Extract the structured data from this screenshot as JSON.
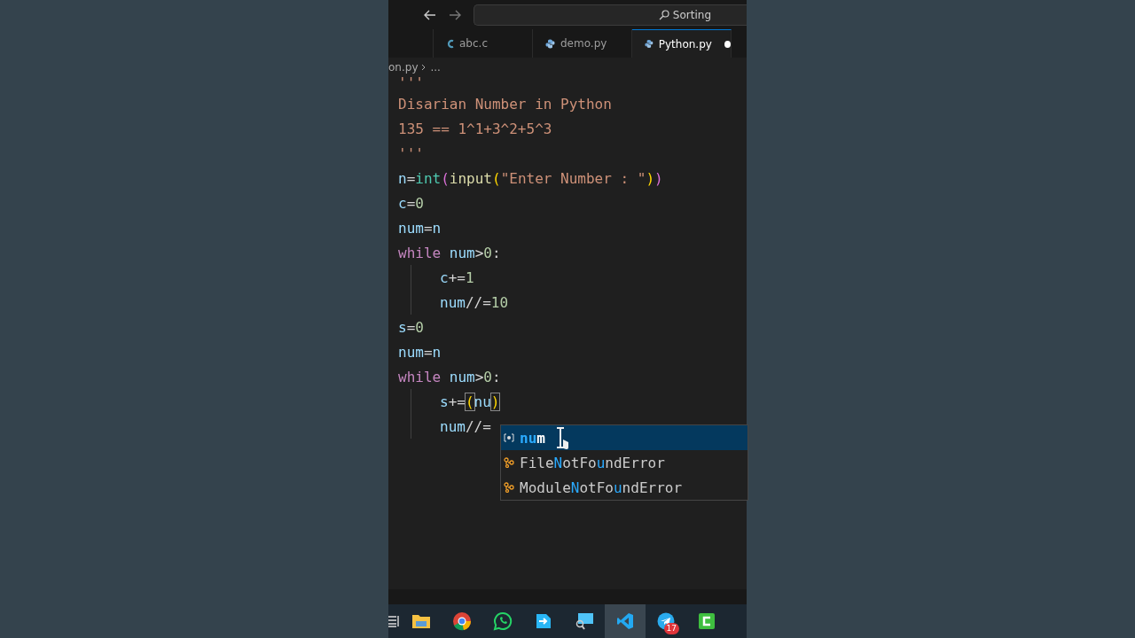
{
  "title_bar": {
    "search": "Sorting"
  },
  "tabs": [
    {
      "label": "abc.c",
      "kind": "c",
      "selected": false,
      "modified": false
    },
    {
      "label": "demo.py",
      "kind": "python",
      "selected": false,
      "modified": false
    },
    {
      "label": "Python.py",
      "kind": "python",
      "selected": true,
      "modified": true
    }
  ],
  "breadcrumb": [
    "on.py",
    "..."
  ],
  "code_lines": [
    {
      "tokens": [
        {
          "text": "'''",
          "kind": "string"
        }
      ]
    },
    {
      "tokens": [
        {
          "text": "Disarian Number in Python",
          "kind": "string"
        }
      ]
    },
    {
      "tokens": [
        {
          "text": "135 == 1^1+3^2+5^3",
          "kind": "string"
        }
      ]
    },
    {
      "tokens": [
        {
          "text": "'''",
          "kind": "string"
        }
      ]
    },
    {
      "tokens": [
        {
          "text": "n",
          "kind": "var"
        },
        {
          "text": "=",
          "kind": "op"
        },
        {
          "text": "int",
          "kind": "builtin"
        },
        {
          "text": "(",
          "kind": "paren"
        },
        {
          "text": "input",
          "kind": "func"
        },
        {
          "text": "(",
          "kind": "paren2"
        },
        {
          "text": "\"Enter Number : \"",
          "kind": "string"
        },
        {
          "text": ")",
          "kind": "paren2"
        },
        {
          "text": ")",
          "kind": "paren"
        }
      ]
    },
    {
      "tokens": [
        {
          "text": "c",
          "kind": "var"
        },
        {
          "text": "=",
          "kind": "op"
        },
        {
          "text": "0",
          "kind": "number"
        }
      ]
    },
    {
      "tokens": [
        {
          "text": "num",
          "kind": "var"
        },
        {
          "text": "=",
          "kind": "op"
        },
        {
          "text": "n",
          "kind": "var"
        }
      ]
    },
    {
      "tokens": [
        {
          "text": "while",
          "kind": "keyword"
        },
        {
          "text": " num",
          "kind": "var"
        },
        {
          "text": ">",
          "kind": "op"
        },
        {
          "text": "0",
          "kind": "number"
        },
        {
          "text": ":",
          "kind": "op"
        }
      ],
      "children": [
        {
          "tokens": [
            {
              "text": "c",
              "kind": "var"
            },
            {
              "text": "+=",
              "kind": "op"
            },
            {
              "text": "1",
              "kind": "number"
            }
          ]
        },
        {
          "tokens": [
            {
              "text": "num",
              "kind": "var"
            },
            {
              "text": "//=",
              "kind": "op"
            },
            {
              "text": "10",
              "kind": "number"
            }
          ]
        }
      ]
    },
    {
      "tokens": [
        {
          "text": "s",
          "kind": "var"
        },
        {
          "text": "=",
          "kind": "op"
        },
        {
          "text": "0",
          "kind": "number"
        }
      ]
    },
    {
      "tokens": [
        {
          "text": "num",
          "kind": "var"
        },
        {
          "text": "=",
          "kind": "op"
        },
        {
          "text": "n",
          "kind": "var"
        }
      ]
    },
    {
      "tokens": [
        {
          "text": "while",
          "kind": "keyword"
        },
        {
          "text": " num",
          "kind": "var"
        },
        {
          "text": ">",
          "kind": "op"
        },
        {
          "text": "0",
          "kind": "number"
        },
        {
          "text": ":",
          "kind": "op"
        }
      ],
      "children": [
        {
          "tokens": [
            {
              "text": "s",
              "kind": "var"
            },
            {
              "text": "+=",
              "kind": "op"
            },
            {
              "text": "(",
              "kind": "matched"
            },
            {
              "text": "nu",
              "kind": "var"
            },
            {
              "text": ")",
              "kind": "matched"
            }
          ]
        },
        {
          "tokens": [
            {
              "text": "num",
              "kind": "var"
            },
            {
              "text": "//=",
              "kind": "op"
            }
          ]
        }
      ]
    }
  ],
  "suggestions": [
    {
      "kind": "variable",
      "selected": true,
      "parts": [
        {
          "text": "nu",
          "match": true
        },
        {
          "text": "m",
          "match": false
        }
      ]
    },
    {
      "kind": "class",
      "selected": false,
      "parts": [
        {
          "text": "File",
          "match": false
        },
        {
          "text": "N",
          "match": true
        },
        {
          "text": "otFo",
          "match": false
        },
        {
          "text": "u",
          "match": true
        },
        {
          "text": "ndError",
          "match": false
        }
      ]
    },
    {
      "kind": "class",
      "selected": false,
      "parts": [
        {
          "text": "Module",
          "match": false
        },
        {
          "text": "N",
          "match": true
        },
        {
          "text": "otFo",
          "match": false
        },
        {
          "text": "u",
          "match": true
        },
        {
          "text": "ndError",
          "match": false
        }
      ]
    }
  ],
  "taskbar": [
    {
      "kind": "widgets",
      "selected": false
    },
    {
      "kind": "folder",
      "selected": false
    },
    {
      "kind": "browser",
      "selected": false
    },
    {
      "kind": "chat",
      "selected": false
    },
    {
      "kind": "share",
      "selected": false
    },
    {
      "kind": "remote",
      "selected": false
    },
    {
      "kind": "editor",
      "selected": true
    },
    {
      "kind": "messenger",
      "selected": false,
      "badge": "17"
    },
    {
      "kind": "recorder",
      "selected": false
    }
  ]
}
